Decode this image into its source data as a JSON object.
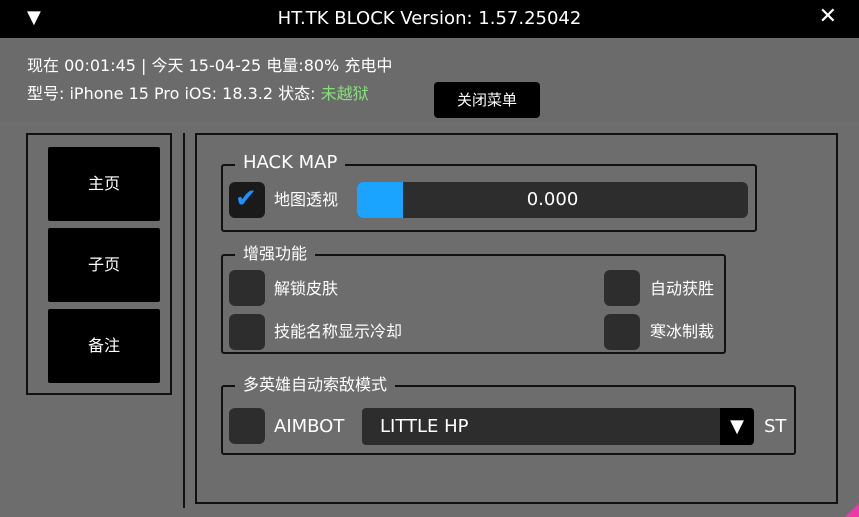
{
  "window": {
    "collapse_icon": "▼",
    "title": "HT.TK BLOCK Version: 1.57.25042",
    "close_icon": "✕"
  },
  "status": {
    "line1": "现在 00:01:45 | 今天 15-04-25  电量:80%  充电中",
    "model_text": "型号: iPhone 15 Pro  iOS: 18.3.2  状态: ",
    "jailbreak_state": "未越狱",
    "close_menu_label": "关闭菜单"
  },
  "nav": {
    "items": [
      {
        "label": "主页"
      },
      {
        "label": "子页"
      },
      {
        "label": "备注"
      }
    ]
  },
  "main": {
    "hack_map": {
      "title": "HACK MAP",
      "checkbox_label": "地图透视",
      "checked": true,
      "slider_value_text": "0.000",
      "slider_fill_fraction": 0.118
    },
    "enhance": {
      "title": "增强功能",
      "items": [
        {
          "label": "解锁皮肤"
        },
        {
          "label": "技能名称显示冷却"
        },
        {
          "label": "自动获胜"
        },
        {
          "label": "寒冰制裁"
        }
      ]
    },
    "aimbot": {
      "title": "多英雄自动索敌模式",
      "checkbox_label": "AIMBOT",
      "dropdown_value": "LITTLE HP",
      "dropdown_arrow": "▼",
      "suffix_label": "ST"
    }
  },
  "colors": {
    "accent": "#1aa3ff",
    "status_green": "#86e07a",
    "panel_bg": "#6d6d6d"
  }
}
